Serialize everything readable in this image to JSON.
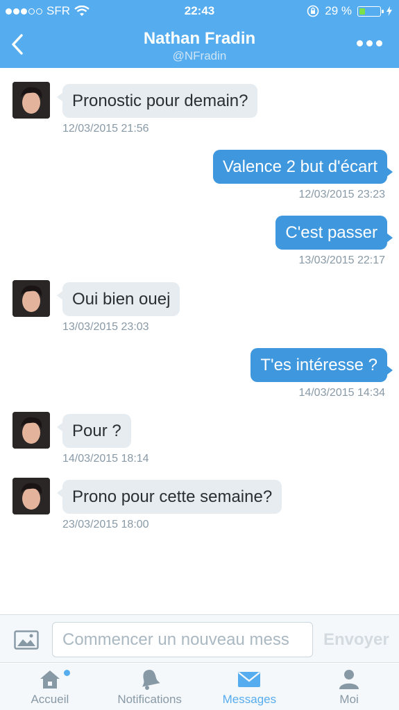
{
  "status_bar": {
    "carrier": "SFR",
    "time": "22:43",
    "battery": "29 %",
    "battery_level": 0.29
  },
  "header": {
    "title": "Nathan Fradin",
    "handle": "@NFradin"
  },
  "messages": [
    {
      "direction": "in",
      "text": "Pronostic pour demain?",
      "timestamp": "12/03/2015 21:56"
    },
    {
      "direction": "out",
      "text": "Valence 2 but d'écart",
      "timestamp": "12/03/2015 23:23"
    },
    {
      "direction": "out",
      "text": "C'est passer",
      "timestamp": "13/03/2015 22:17"
    },
    {
      "direction": "in",
      "text": "Oui bien ouej",
      "timestamp": "13/03/2015 23:03"
    },
    {
      "direction": "out",
      "text": "T'es intéresse ?",
      "timestamp": "14/03/2015 14:34"
    },
    {
      "direction": "in",
      "text": "Pour ?",
      "timestamp": "14/03/2015 18:14"
    },
    {
      "direction": "in",
      "text": "Prono pour cette semaine?",
      "timestamp": "23/03/2015 18:00"
    }
  ],
  "composer": {
    "placeholder": "Commencer un nouveau mess",
    "send_label": "Envoyer"
  },
  "tabs": [
    {
      "label": "Accueil",
      "icon": "home-icon",
      "active": false
    },
    {
      "label": "Notifications",
      "icon": "bell-icon",
      "active": false
    },
    {
      "label": "Messages",
      "icon": "envelope-icon",
      "active": true
    },
    {
      "label": "Moi",
      "icon": "person-icon",
      "active": false
    }
  ],
  "colors": {
    "accent": "#55acee",
    "outgoing_bubble": "#3f97de",
    "incoming_bubble": "#e6ecf0",
    "battery_fill": "#7ce04a"
  }
}
